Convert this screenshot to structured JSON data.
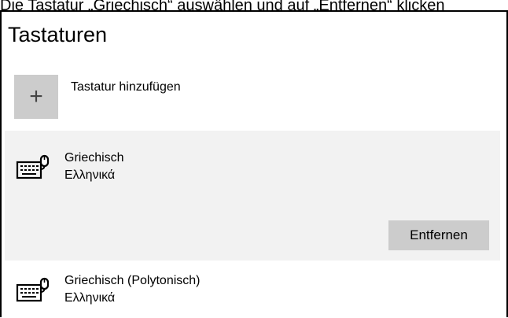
{
  "caption": "Die Tastatur „Griechisch“ auswählen und auf „Entfernen“ klicken",
  "page": {
    "heading": "Tastaturen"
  },
  "add_keyboard": {
    "icon": "plus-icon",
    "label": "Tastatur hinzufügen"
  },
  "keyboards": [
    {
      "name": "Griechisch",
      "native_name": "Ελληνικά",
      "icon": "keyboard-icon",
      "selected": true
    },
    {
      "name": "Griechisch (Polytonisch)",
      "native_name": "Ελληνικά",
      "icon": "keyboard-icon",
      "selected": false
    }
  ],
  "actions": {
    "remove_label": "Entfernen"
  },
  "colors": {
    "selected_background": "#f2f2f2",
    "tile_gray": "#cccccc"
  }
}
